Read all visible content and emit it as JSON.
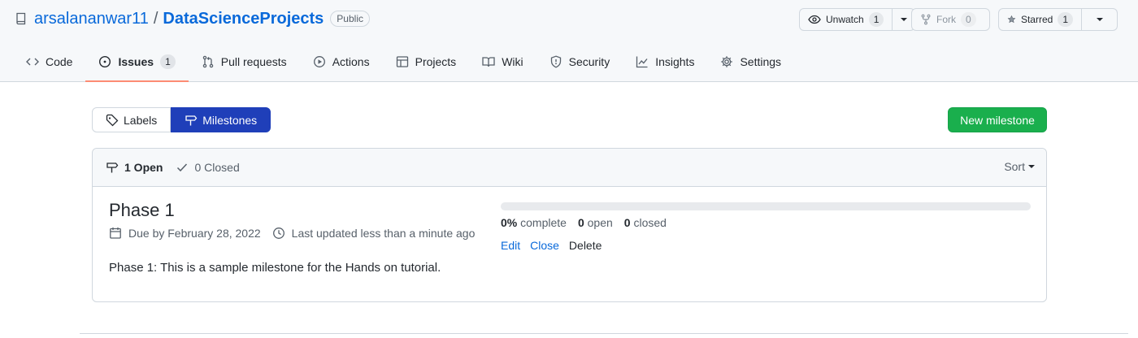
{
  "repo": {
    "owner": "arsalananwar11",
    "name": "DataScienceProjects",
    "visibility": "Public"
  },
  "repo_actions": {
    "watch": {
      "label": "Unwatch",
      "count": "1"
    },
    "fork": {
      "label": "Fork",
      "count": "0"
    },
    "star": {
      "label": "Starred",
      "count": "1"
    }
  },
  "tabs": [
    {
      "label": "Code",
      "icon": "code-icon"
    },
    {
      "label": "Issues",
      "icon": "issue-opened-icon",
      "count": "1",
      "active": true
    },
    {
      "label": "Pull requests",
      "icon": "git-pull-request-icon"
    },
    {
      "label": "Actions",
      "icon": "play-icon"
    },
    {
      "label": "Projects",
      "icon": "table-icon"
    },
    {
      "label": "Wiki",
      "icon": "book-icon"
    },
    {
      "label": "Security",
      "icon": "shield-icon"
    },
    {
      "label": "Insights",
      "icon": "graph-icon"
    },
    {
      "label": "Settings",
      "icon": "gear-icon"
    }
  ],
  "subnav": {
    "labels": "Labels",
    "milestones": "Milestones"
  },
  "new_milestone_label": "New milestone",
  "filters": {
    "open": "1 Open",
    "closed": "0 Closed",
    "sort": "Sort"
  },
  "milestone": {
    "title": "Phase 1",
    "due": "Due by February 28, 2022",
    "updated": "Last updated less than a minute ago",
    "description": "Phase 1: This is a sample milestone for the Hands on tutorial.",
    "progress_fraction": 0,
    "percent": "0%",
    "complete_label": "complete",
    "open_count": "0",
    "open_label": "open",
    "closed_count": "0",
    "closed_label": "closed",
    "actions": {
      "edit": "Edit",
      "close": "Close",
      "delete": "Delete"
    }
  },
  "colors": {
    "accent": "#0969da",
    "selected_subnav": "#1f3fb9",
    "primary_button": "#1aaf4d",
    "active_tab_underline": "#fd8c73"
  }
}
